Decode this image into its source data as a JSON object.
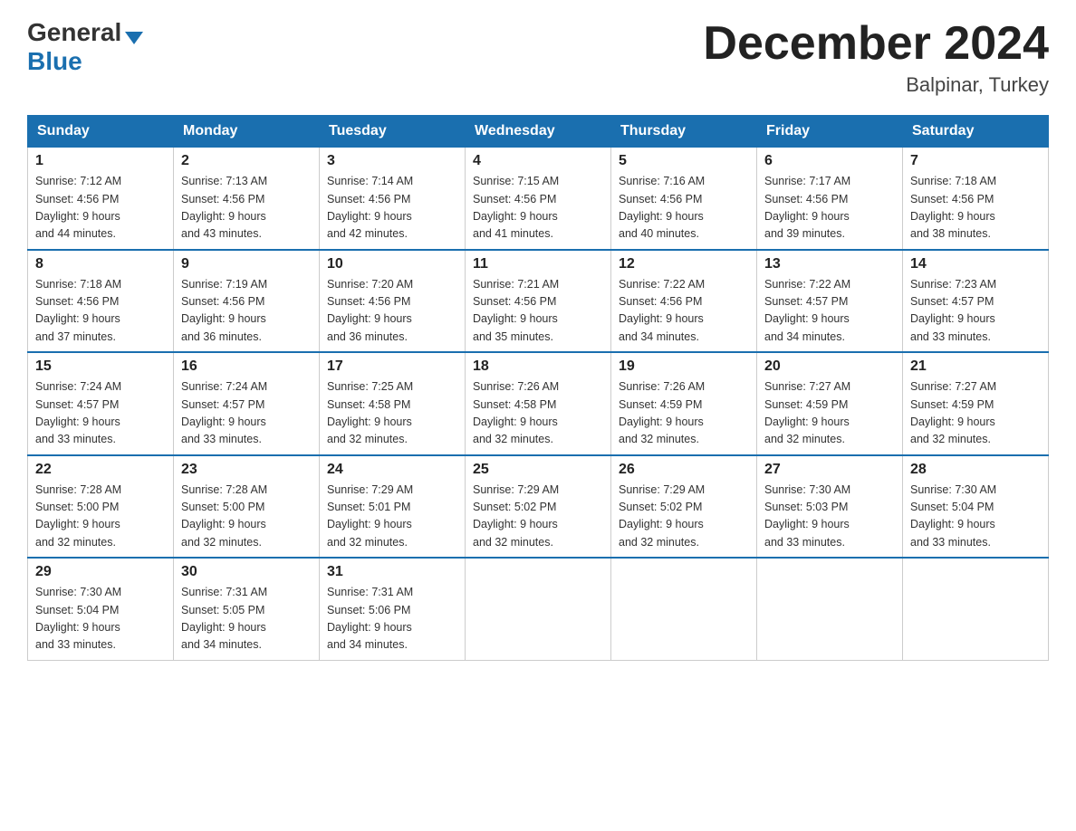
{
  "logo": {
    "general": "General",
    "blue": "Blue"
  },
  "title": "December 2024",
  "location": "Balpinar, Turkey",
  "weekdays": [
    "Sunday",
    "Monday",
    "Tuesday",
    "Wednesday",
    "Thursday",
    "Friday",
    "Saturday"
  ],
  "weeks": [
    [
      {
        "day": "1",
        "sunrise": "7:12 AM",
        "sunset": "4:56 PM",
        "daylight": "9 hours and 44 minutes."
      },
      {
        "day": "2",
        "sunrise": "7:13 AM",
        "sunset": "4:56 PM",
        "daylight": "9 hours and 43 minutes."
      },
      {
        "day": "3",
        "sunrise": "7:14 AM",
        "sunset": "4:56 PM",
        "daylight": "9 hours and 42 minutes."
      },
      {
        "day": "4",
        "sunrise": "7:15 AM",
        "sunset": "4:56 PM",
        "daylight": "9 hours and 41 minutes."
      },
      {
        "day": "5",
        "sunrise": "7:16 AM",
        "sunset": "4:56 PM",
        "daylight": "9 hours and 40 minutes."
      },
      {
        "day": "6",
        "sunrise": "7:17 AM",
        "sunset": "4:56 PM",
        "daylight": "9 hours and 39 minutes."
      },
      {
        "day": "7",
        "sunrise": "7:18 AM",
        "sunset": "4:56 PM",
        "daylight": "9 hours and 38 minutes."
      }
    ],
    [
      {
        "day": "8",
        "sunrise": "7:18 AM",
        "sunset": "4:56 PM",
        "daylight": "9 hours and 37 minutes."
      },
      {
        "day": "9",
        "sunrise": "7:19 AM",
        "sunset": "4:56 PM",
        "daylight": "9 hours and 36 minutes."
      },
      {
        "day": "10",
        "sunrise": "7:20 AM",
        "sunset": "4:56 PM",
        "daylight": "9 hours and 36 minutes."
      },
      {
        "day": "11",
        "sunrise": "7:21 AM",
        "sunset": "4:56 PM",
        "daylight": "9 hours and 35 minutes."
      },
      {
        "day": "12",
        "sunrise": "7:22 AM",
        "sunset": "4:56 PM",
        "daylight": "9 hours and 34 minutes."
      },
      {
        "day": "13",
        "sunrise": "7:22 AM",
        "sunset": "4:57 PM",
        "daylight": "9 hours and 34 minutes."
      },
      {
        "day": "14",
        "sunrise": "7:23 AM",
        "sunset": "4:57 PM",
        "daylight": "9 hours and 33 minutes."
      }
    ],
    [
      {
        "day": "15",
        "sunrise": "7:24 AM",
        "sunset": "4:57 PM",
        "daylight": "9 hours and 33 minutes."
      },
      {
        "day": "16",
        "sunrise": "7:24 AM",
        "sunset": "4:57 PM",
        "daylight": "9 hours and 33 minutes."
      },
      {
        "day": "17",
        "sunrise": "7:25 AM",
        "sunset": "4:58 PM",
        "daylight": "9 hours and 32 minutes."
      },
      {
        "day": "18",
        "sunrise": "7:26 AM",
        "sunset": "4:58 PM",
        "daylight": "9 hours and 32 minutes."
      },
      {
        "day": "19",
        "sunrise": "7:26 AM",
        "sunset": "4:59 PM",
        "daylight": "9 hours and 32 minutes."
      },
      {
        "day": "20",
        "sunrise": "7:27 AM",
        "sunset": "4:59 PM",
        "daylight": "9 hours and 32 minutes."
      },
      {
        "day": "21",
        "sunrise": "7:27 AM",
        "sunset": "4:59 PM",
        "daylight": "9 hours and 32 minutes."
      }
    ],
    [
      {
        "day": "22",
        "sunrise": "7:28 AM",
        "sunset": "5:00 PM",
        "daylight": "9 hours and 32 minutes."
      },
      {
        "day": "23",
        "sunrise": "7:28 AM",
        "sunset": "5:00 PM",
        "daylight": "9 hours and 32 minutes."
      },
      {
        "day": "24",
        "sunrise": "7:29 AM",
        "sunset": "5:01 PM",
        "daylight": "9 hours and 32 minutes."
      },
      {
        "day": "25",
        "sunrise": "7:29 AM",
        "sunset": "5:02 PM",
        "daylight": "9 hours and 32 minutes."
      },
      {
        "day": "26",
        "sunrise": "7:29 AM",
        "sunset": "5:02 PM",
        "daylight": "9 hours and 32 minutes."
      },
      {
        "day": "27",
        "sunrise": "7:30 AM",
        "sunset": "5:03 PM",
        "daylight": "9 hours and 33 minutes."
      },
      {
        "day": "28",
        "sunrise": "7:30 AM",
        "sunset": "5:04 PM",
        "daylight": "9 hours and 33 minutes."
      }
    ],
    [
      {
        "day": "29",
        "sunrise": "7:30 AM",
        "sunset": "5:04 PM",
        "daylight": "9 hours and 33 minutes."
      },
      {
        "day": "30",
        "sunrise": "7:31 AM",
        "sunset": "5:05 PM",
        "daylight": "9 hours and 34 minutes."
      },
      {
        "day": "31",
        "sunrise": "7:31 AM",
        "sunset": "5:06 PM",
        "daylight": "9 hours and 34 minutes."
      },
      null,
      null,
      null,
      null
    ]
  ]
}
